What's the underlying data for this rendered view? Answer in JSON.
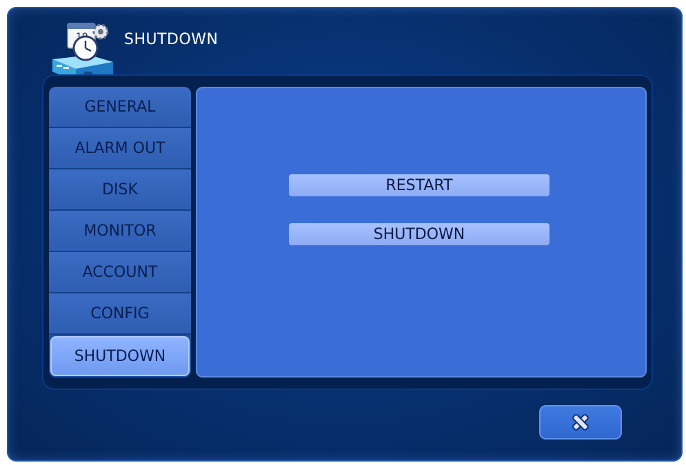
{
  "window": {
    "title": "SHUTDOWN"
  },
  "icons": {
    "app": "clock-calendar-device-icon",
    "close": "close-x-icon"
  },
  "sidebar": {
    "items": [
      {
        "label": "GENERAL",
        "active": false
      },
      {
        "label": "ALARM OUT",
        "active": false
      },
      {
        "label": "DISK",
        "active": false
      },
      {
        "label": "MONITOR",
        "active": false
      },
      {
        "label": "ACCOUNT",
        "active": false
      },
      {
        "label": "CONFIG",
        "active": false
      },
      {
        "label": "SHUTDOWN",
        "active": true
      }
    ]
  },
  "main": {
    "restart_label": "RESTART",
    "shutdown_label": "SHUTDOWN"
  },
  "colors": {
    "window_bg": "#07306f",
    "content_bg": "#3a6ed6",
    "tab_bg": "#2e5db2",
    "tab_active_bg": "#8fb3ff",
    "button_bg": "#a7c1ff"
  }
}
